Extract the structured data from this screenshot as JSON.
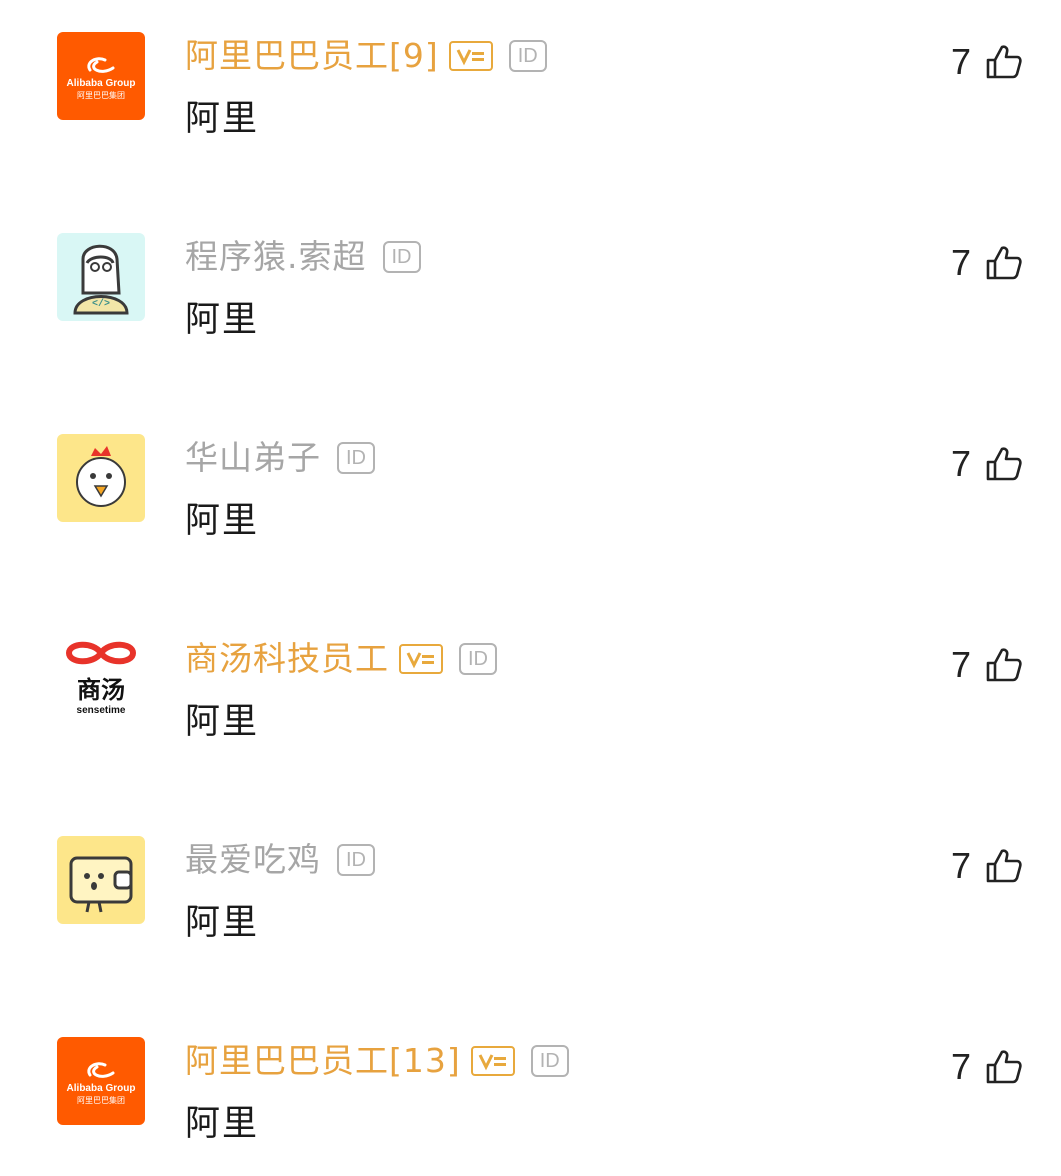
{
  "comments": [
    {
      "name": "阿里巴巴员工[9]",
      "name_style": "vip",
      "has_vip_badge": true,
      "id_badge": "ID",
      "text": "阿里",
      "likes": "7",
      "avatar_icon": "alibaba-logo-icon"
    },
    {
      "name": "程序猿.索超",
      "name_style": "normal",
      "has_vip_badge": false,
      "id_badge": "ID",
      "text": "阿里",
      "likes": "7",
      "avatar_icon": "programmer-avatar-icon"
    },
    {
      "name": "华山弟子",
      "name_style": "normal",
      "has_vip_badge": false,
      "id_badge": "ID",
      "text": "阿里",
      "likes": "7",
      "avatar_icon": "chicken-avatar-icon"
    },
    {
      "name": "商汤科技员工",
      "name_style": "vip",
      "has_vip_badge": true,
      "id_badge": "ID",
      "text": "阿里",
      "likes": "7",
      "avatar_icon": "sensetime-logo-icon"
    },
    {
      "name": "最爱吃鸡",
      "name_style": "normal",
      "has_vip_badge": false,
      "id_badge": "ID",
      "text": "阿里",
      "likes": "7",
      "avatar_icon": "wallet-avatar-icon"
    },
    {
      "name": "阿里巴巴员工[13]",
      "name_style": "vip",
      "has_vip_badge": true,
      "id_badge": "ID",
      "text": "阿里",
      "likes": "7",
      "avatar_icon": "alibaba-logo-icon"
    }
  ],
  "logo_text": {
    "alibaba_top": "Alibaba Group",
    "alibaba_bottom": "阿里巴巴集团",
    "sensetime_cn": "商汤",
    "sensetime_en": "sensetime"
  },
  "colors": {
    "vip_name": "#e7a23f",
    "normal_name": "#a6a6a6",
    "alibaba_orange": "#ff5a00",
    "sensetime_red": "#e8332a",
    "avatar_yellow": "#fde68a",
    "avatar_cyan": "#d9f7f5"
  }
}
